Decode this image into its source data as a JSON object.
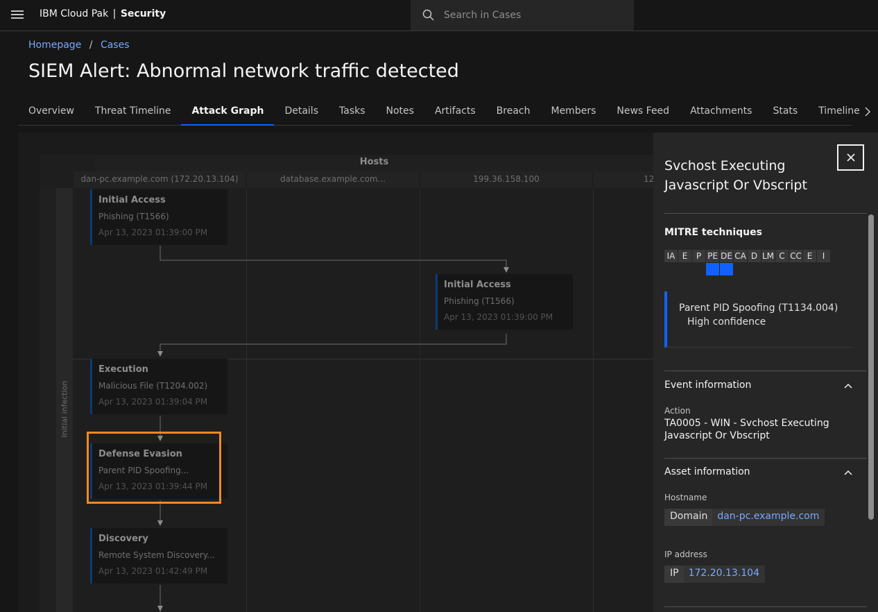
{
  "header": {
    "brand": "IBM Cloud Pak",
    "separator": "|",
    "product": "Security",
    "search_placeholder": "Search in Cases"
  },
  "breadcrumb": {
    "home": "Homepage",
    "separator": "/",
    "cases": "Cases"
  },
  "page_title": "SIEM Alert: Abnormal network traffic detected",
  "tabs": [
    {
      "label": "Overview",
      "active": false
    },
    {
      "label": "Threat Timeline",
      "active": false
    },
    {
      "label": "Attack Graph",
      "active": true
    },
    {
      "label": "Details",
      "active": false
    },
    {
      "label": "Tasks",
      "active": false
    },
    {
      "label": "Notes",
      "active": false
    },
    {
      "label": "Artifacts",
      "active": false
    },
    {
      "label": "Breach",
      "active": false
    },
    {
      "label": "Members",
      "active": false
    },
    {
      "label": "News Feed",
      "active": false
    },
    {
      "label": "Attachments",
      "active": false
    },
    {
      "label": "Stats",
      "active": false
    },
    {
      "label": "Timeline",
      "active": false
    }
  ],
  "graph": {
    "hosts_title": "Hosts",
    "hosts": [
      "dan-pc.example.com (172.20.13.104)",
      "database.example.com...",
      "199.36.158.100",
      "12"
    ],
    "phase_label": "Initial infection",
    "nodes": [
      {
        "title": "Initial Access",
        "technique": "Phishing (T1566)",
        "time": "Apr 13, 2023 01:39:00 PM"
      },
      {
        "title": "Initial Access",
        "technique": "Phishing (T1566)",
        "time": "Apr 13, 2023 01:39:00 PM"
      },
      {
        "title": "Execution",
        "technique": "Malicious File (T1204.002)",
        "time": "Apr 13, 2023 01:39:04 PM"
      },
      {
        "title": "Defense Evasion",
        "technique": "Parent PID Spoofing...",
        "time": "Apr 13, 2023 01:39:44 PM"
      },
      {
        "title": "Discovery",
        "technique": "Remote System Discovery...",
        "time": "Apr 13, 2023 01:42:49 PM"
      }
    ]
  },
  "panel": {
    "title": "Svchost Executing Javascript Or Vbscript",
    "mitre_heading": "MITRE techniques",
    "mitre_tactics": [
      {
        "abbr": "IA",
        "active": false
      },
      {
        "abbr": "E",
        "active": false
      },
      {
        "abbr": "P",
        "active": false
      },
      {
        "abbr": "PE",
        "active": true
      },
      {
        "abbr": "DE",
        "active": true
      },
      {
        "abbr": "CA",
        "active": false
      },
      {
        "abbr": "D",
        "active": false
      },
      {
        "abbr": "LM",
        "active": false
      },
      {
        "abbr": "C",
        "active": false
      },
      {
        "abbr": "CC",
        "active": false
      },
      {
        "abbr": "E",
        "active": false
      },
      {
        "abbr": "I",
        "active": false
      }
    ],
    "technique_name": "Parent PID Spoofing (T1134.004)",
    "technique_confidence": "High confidence",
    "event_heading": "Event information",
    "action_label": "Action",
    "action_value": "TA0005 - WIN - Svchost Executing Javascript Or Vbscript",
    "asset_heading": "Asset information",
    "hostname_label": "Hostname",
    "hostname_key": "Domain",
    "hostname_value": "dan-pc.example.com",
    "ip_label": "IP address",
    "ip_key": "IP",
    "ip_value": "172.20.13.104"
  },
  "colors": {
    "accent": "#0f62fe",
    "link": "#78a9ff",
    "highlight": "#f08a24"
  }
}
